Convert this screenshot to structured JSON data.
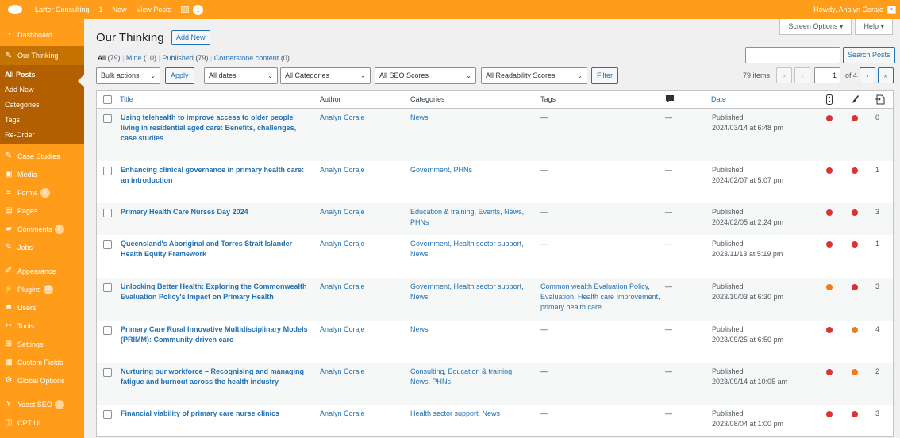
{
  "adminbar": {
    "site_name": "Larter Consulting",
    "updates_count": "1",
    "new_label": "New",
    "view_posts_label": "View Posts",
    "yoast_count": "1",
    "howdy": "Howdy, Analyn Coraje"
  },
  "sidebar": {
    "items": [
      {
        "label": "Dashboard",
        "icon": "dashboard-icon"
      },
      {
        "label": "Our Thinking",
        "icon": "pin-icon"
      },
      {
        "label": "Case Studies",
        "icon": "pin-icon"
      },
      {
        "label": "Media",
        "icon": "media-icon"
      },
      {
        "label": "Forms",
        "icon": "forms-icon",
        "badge": "1"
      },
      {
        "label": "Pages",
        "icon": "pages-icon"
      },
      {
        "label": "Comments",
        "icon": "comments-icon",
        "badge": "1"
      },
      {
        "label": "Jobs",
        "icon": "pin-icon"
      },
      {
        "label": "Appearance",
        "icon": "appearance-icon"
      },
      {
        "label": "Plugins",
        "icon": "plugins-icon",
        "badge": "10"
      },
      {
        "label": "Users",
        "icon": "users-icon"
      },
      {
        "label": "Tools",
        "icon": "tools-icon"
      },
      {
        "label": "Settings",
        "icon": "settings-icon"
      },
      {
        "label": "Custom Fields",
        "icon": "custom-fields-icon"
      },
      {
        "label": "Global Options",
        "icon": "global-options-icon"
      },
      {
        "label": "Yoast SEO",
        "icon": "yoast-icon",
        "badge": "1"
      },
      {
        "label": "CPT UI",
        "icon": "cpt-ui-icon"
      }
    ],
    "submenu": [
      "All Posts",
      "Add New",
      "Categories",
      "Tags",
      "Re-Order"
    ]
  },
  "header": {
    "title": "Our Thinking",
    "add_new": "Add New",
    "screen_options": "Screen Options",
    "help": "Help"
  },
  "views": {
    "all": "All",
    "all_count": "(79)",
    "mine": "Mine",
    "mine_count": "(10)",
    "published": "Published",
    "published_count": "(79)",
    "cornerstone": "Cornerstone content",
    "cornerstone_count": "(0)"
  },
  "search": {
    "button": "Search Posts"
  },
  "filters": {
    "bulk_actions": "Bulk actions",
    "apply": "Apply",
    "dates": "All dates",
    "categories": "All Categories",
    "seo": "All SEO Scores",
    "readability": "All Readability Scores",
    "filter": "Filter"
  },
  "pagination": {
    "items": "79 items",
    "current_page": "1",
    "of": "of 4",
    "first": "«",
    "prev": "‹",
    "next": "›",
    "last": "»"
  },
  "columns": {
    "title": "Title",
    "author": "Author",
    "categories": "Categories",
    "tags": "Tags",
    "date": "Date"
  },
  "colors": {
    "brand": "#ff9c1a",
    "red": "#dc3232",
    "orange": "#ee7c1b",
    "link": "#2271b1"
  },
  "rows": [
    {
      "title": "Using telehealth to improve access to older people living in residential aged care: Benefits, challenges, case studies",
      "author": "Analyn Coraje",
      "categories": "News",
      "tags": "—",
      "comments": "—",
      "status": "Published",
      "date": "2024/03/14 at 6:48 pm",
      "seo": "red",
      "readability": "red",
      "links": "0"
    },
    {
      "title": "Enhancing clinical governance in primary health care: an introduction",
      "author": "Analyn Coraje",
      "categories": "Government, PHNs",
      "tags": "—",
      "comments": "—",
      "status": "Published",
      "date": "2024/02/07 at 5:07 pm",
      "seo": "red",
      "readability": "red",
      "links": "1"
    },
    {
      "title": "Primary Health Care Nurses Day 2024",
      "author": "Analyn Coraje",
      "categories": "Education & training, Events, News, PHNs",
      "tags": "—",
      "comments": "—",
      "status": "Published",
      "date": "2024/02/05 at 2:24 pm",
      "seo": "red",
      "readability": "red",
      "links": "3"
    },
    {
      "title": "Queensland's Aboriginal and Torres Strait Islander Health Equity Framework",
      "author": "Analyn Coraje",
      "categories": "Government, Health sector support, News",
      "tags": "—",
      "comments": "—",
      "status": "Published",
      "date": "2023/11/13 at 5:19 pm",
      "seo": "red",
      "readability": "red",
      "links": "1"
    },
    {
      "title": "Unlocking Better Health: Exploring the Commonwealth Evaluation Policy's Impact on Primary Health",
      "author": "Analyn Coraje",
      "categories": "Government, Health sector support, News",
      "tags": "Common wealth Evaluation Policy, Evaluation, Health care Improvement, primary health care",
      "comments": "—",
      "status": "Published",
      "date": "2023/10/03 at 6:30 pm",
      "seo": "orange",
      "readability": "red",
      "links": "3"
    },
    {
      "title": "Primary Care Rural Innovative Multidisciplinary Models (PRIMM): Community-driven care",
      "author": "Analyn Coraje",
      "categories": "News",
      "tags": "—",
      "comments": "—",
      "status": "Published",
      "date": "2023/09/25 at 6:50 pm",
      "seo": "red",
      "readability": "orange",
      "links": "4"
    },
    {
      "title": "Nurturing our workforce – Recognising and managing fatigue and burnout across the health industry",
      "author": "Analyn Coraje",
      "categories": "Consulting, Education & training, News, PHNs",
      "tags": "—",
      "comments": "—",
      "status": "Published",
      "date": "2023/09/14 at 10:05 am",
      "seo": "red",
      "readability": "orange",
      "links": "2"
    },
    {
      "title": "Financial viability of primary care nurse clinics",
      "author": "Analyn Coraje",
      "categories": "Health sector support, News",
      "tags": "—",
      "comments": "—",
      "status": "Published",
      "date": "2023/08/04 at 1:00 pm",
      "seo": "red",
      "readability": "red",
      "links": "3"
    }
  ]
}
